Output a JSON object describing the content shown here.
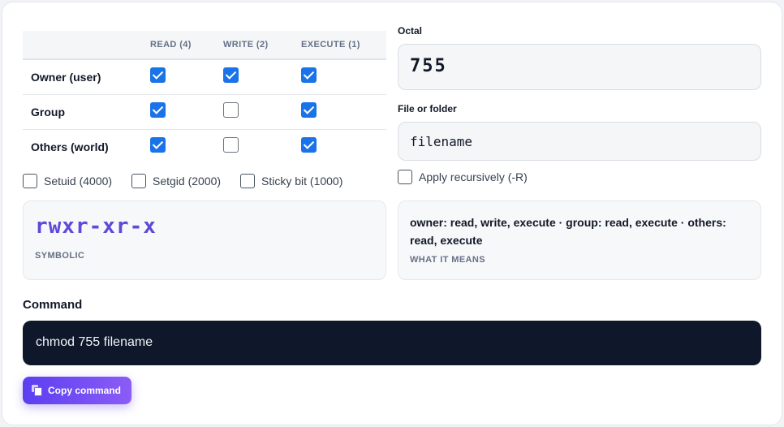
{
  "table": {
    "columns": [
      "READ (4)",
      "WRITE (2)",
      "EXECUTE (1)"
    ],
    "rows": [
      {
        "label": "Owner (user)",
        "checks": [
          true,
          true,
          true
        ]
      },
      {
        "label": "Group",
        "checks": [
          true,
          false,
          true
        ]
      },
      {
        "label": "Others (world)",
        "checks": [
          true,
          false,
          true
        ]
      }
    ]
  },
  "special_bits": [
    {
      "label": "Setuid (4000)",
      "checked": false
    },
    {
      "label": "Setgid (2000)",
      "checked": false
    },
    {
      "label": "Sticky bit (1000)",
      "checked": false
    }
  ],
  "symbolic": {
    "value": "rwxr-xr-x",
    "caption": "SYMBOLIC"
  },
  "octal": {
    "label": "Octal",
    "value": "755"
  },
  "target": {
    "label": "File or folder",
    "value": "filename"
  },
  "recursive": {
    "label": "Apply recursively (-R)",
    "checked": false
  },
  "meaning": {
    "text": "owner: read, write, execute · group: read, execute · others: read, execute",
    "caption": "WHAT IT MEANS"
  },
  "command": {
    "title": "Command",
    "value": "chmod 755 filename"
  },
  "copy_button": {
    "label": "Copy command"
  },
  "colors": {
    "accent": "#1a73e8",
    "symbolic": "#5b4bd8",
    "command_bg": "#0f172a",
    "button": "#6d4cf2"
  }
}
